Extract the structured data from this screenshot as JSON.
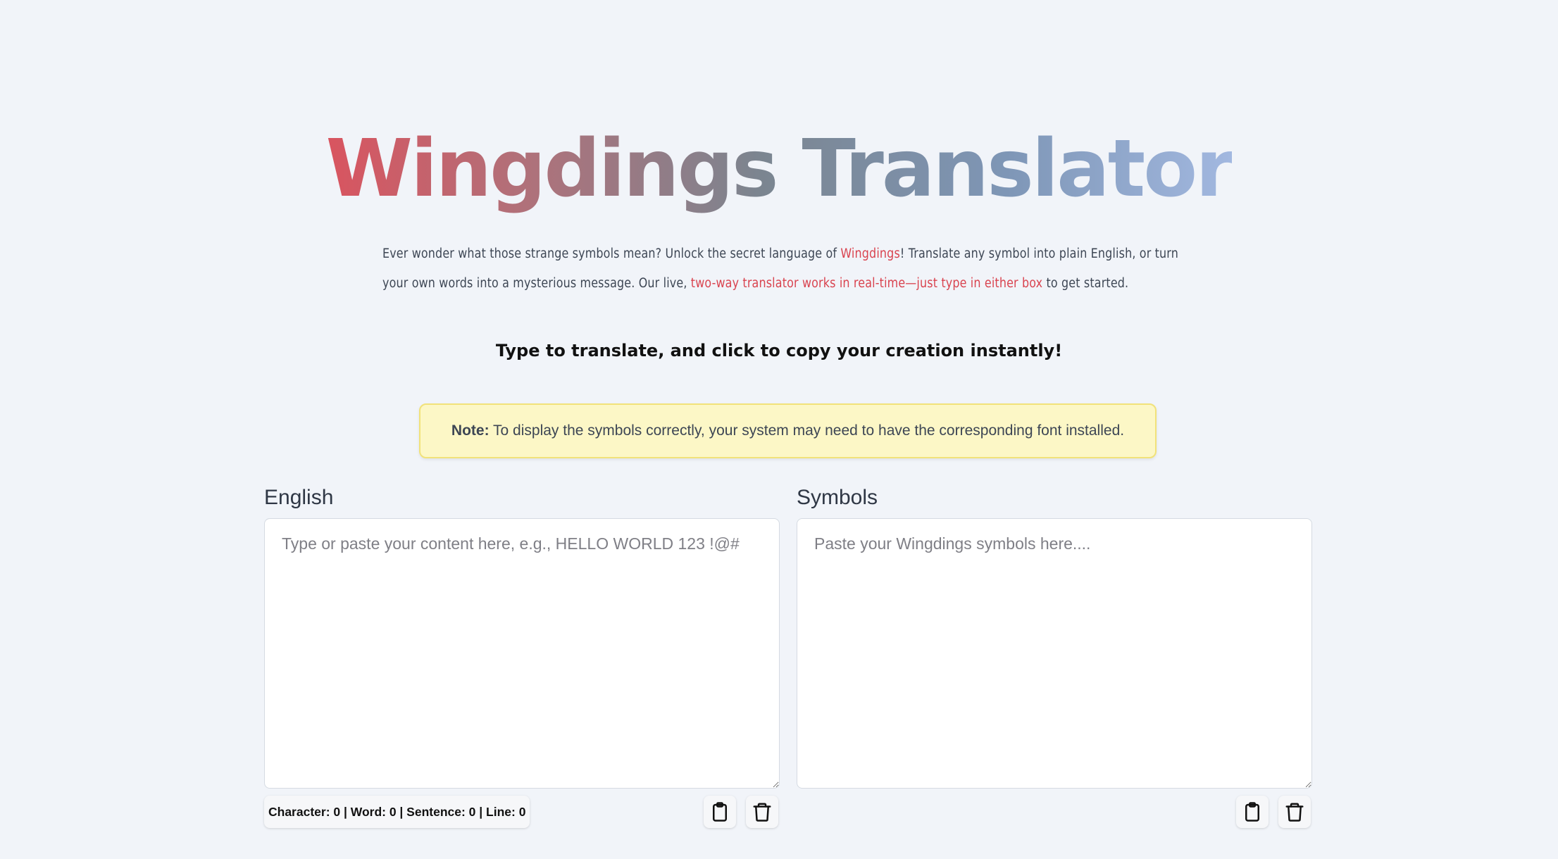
{
  "header": {
    "title": "Wingdings Translator"
  },
  "intro": {
    "part1": "Ever wonder what those strange symbols mean? Unlock the secret language of ",
    "link1": "Wingdings",
    "part2": "! Translate any symbol into plain English, or turn your own words into a mysterious message. Our live, ",
    "highlight": "two-way translator works in real-time—just type in either box",
    "part3": " to get started."
  },
  "subhead": "Type to translate, and click to copy your creation instantly!",
  "note": {
    "label": "Note:",
    "text": " To display the symbols correctly, your system may need to have the corresponding font installed."
  },
  "english_panel": {
    "label": "English",
    "placeholder": "Type or paste your content here, e.g., HELLO WORLD 123 !@#",
    "value": "",
    "stats": "Character: 0 | Word: 0 | Sentence: 0 | Line: 0",
    "copy_icon": "clipboard-icon",
    "clear_icon": "trash-icon"
  },
  "symbols_panel": {
    "label": "Symbols",
    "placeholder": "Paste your Wingdings symbols here....",
    "value": "",
    "copy_icon": "clipboard-icon",
    "clear_icon": "trash-icon"
  },
  "colors": {
    "background": "#f1f4f9",
    "title_gradient_start": "#d9545f",
    "title_gradient_end": "#a2b8e0",
    "highlight_text": "#d9434f",
    "note_background": "#fcf7c6",
    "note_border": "#f1e27a"
  }
}
